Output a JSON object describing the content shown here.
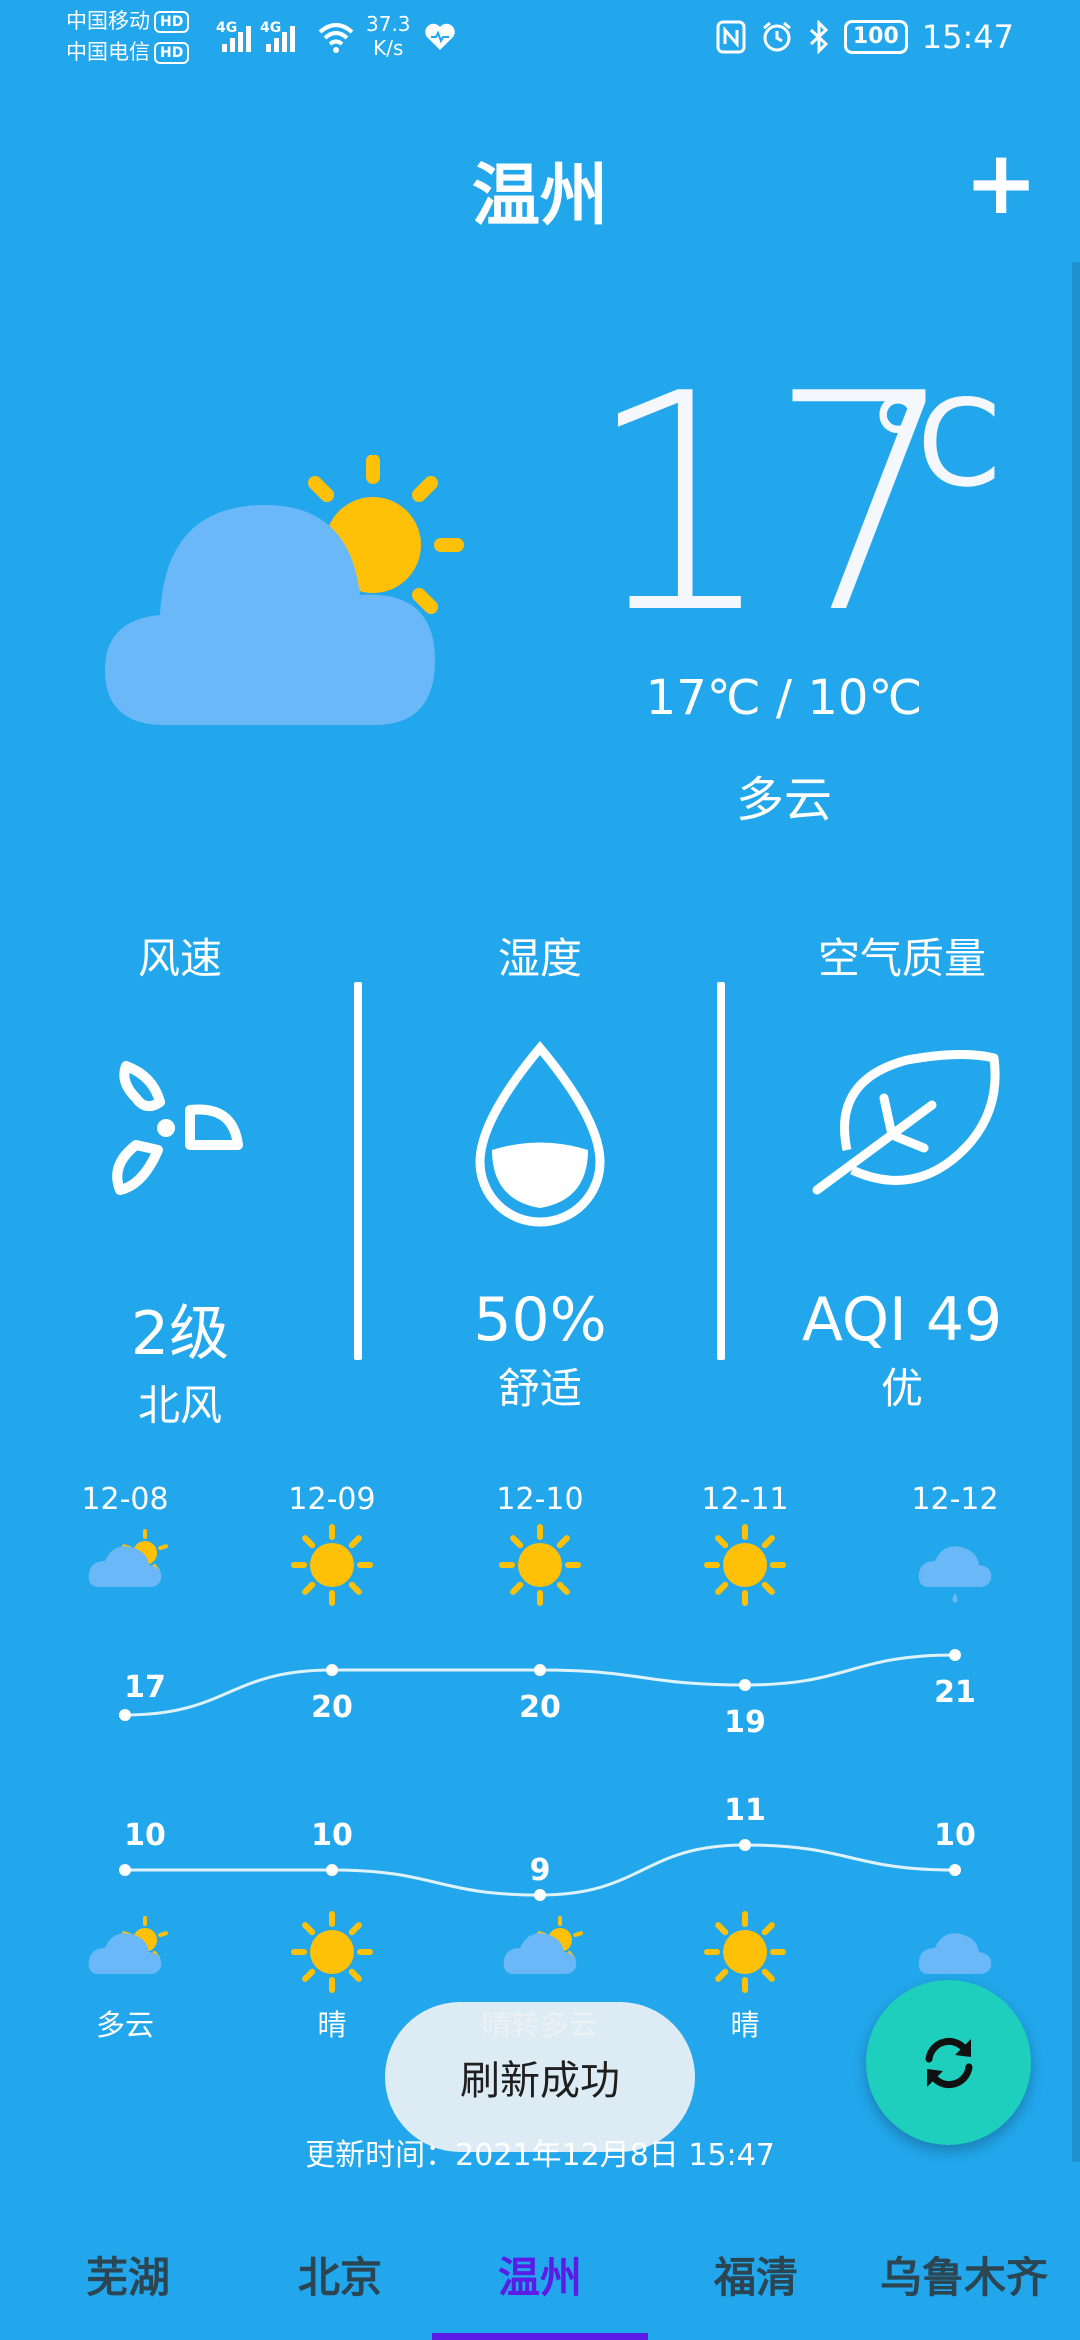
{
  "status_bar": {
    "carrier1": "中国移动",
    "carrier2": "中国电信",
    "hd_badge": "HD",
    "network_type": "4G",
    "speed_value": "37.3",
    "speed_unit": "K/s",
    "battery": "100",
    "time": "15:47",
    "icons": [
      "signal-icon",
      "wifi-icon",
      "heart-icon",
      "nfc-icon",
      "alarm-icon",
      "bluetooth-icon",
      "battery-icon"
    ]
  },
  "header": {
    "city": "温州",
    "add_icon": "plus-icon"
  },
  "current": {
    "temperature": "17",
    "unit": "℃",
    "hi_lo": "17℃ / 10℃",
    "condition": "多云",
    "icon": "partly-cloudy-icon"
  },
  "details": {
    "wind": {
      "title": "风速",
      "value": "2级",
      "sub": "北风",
      "icon": "fan-icon"
    },
    "humidity": {
      "title": "湿度",
      "value": "50%",
      "sub": "舒适",
      "icon": "water-drop-icon"
    },
    "air": {
      "title": "空气质量",
      "value": "AQI 49",
      "sub": "优",
      "icon": "leaf-icon"
    }
  },
  "forecast": {
    "dates": [
      "12-08",
      "12-09",
      "12-10",
      "12-11",
      "12-12"
    ],
    "top_icons": [
      "partly-cloudy-icon",
      "sun-icon",
      "sun-icon",
      "sun-icon",
      "rain-cloud-icon"
    ],
    "high": [
      17,
      20,
      20,
      19,
      21
    ],
    "low": [
      10,
      10,
      9,
      11,
      10
    ],
    "bottom_icons": [
      "partly-cloudy-icon",
      "sun-icon",
      "partly-cloudy-icon",
      "sun-icon",
      "cloud-icon"
    ],
    "labels": [
      "多云",
      "晴",
      "晴转多云",
      "晴",
      ""
    ]
  },
  "toast": "刷新成功",
  "update_time": "更新时间：2021年12月8日 15:47",
  "tabs": [
    "芜湖",
    "北京",
    "温州",
    "福清",
    "乌鲁木齐"
  ],
  "active_tab": 2,
  "colors": {
    "background": "#22a7ec",
    "sun": "#ffc107",
    "cloud": "#6ab8f7",
    "fab": "#1ecfbd",
    "active_tab": "#5b1de6"
  }
}
